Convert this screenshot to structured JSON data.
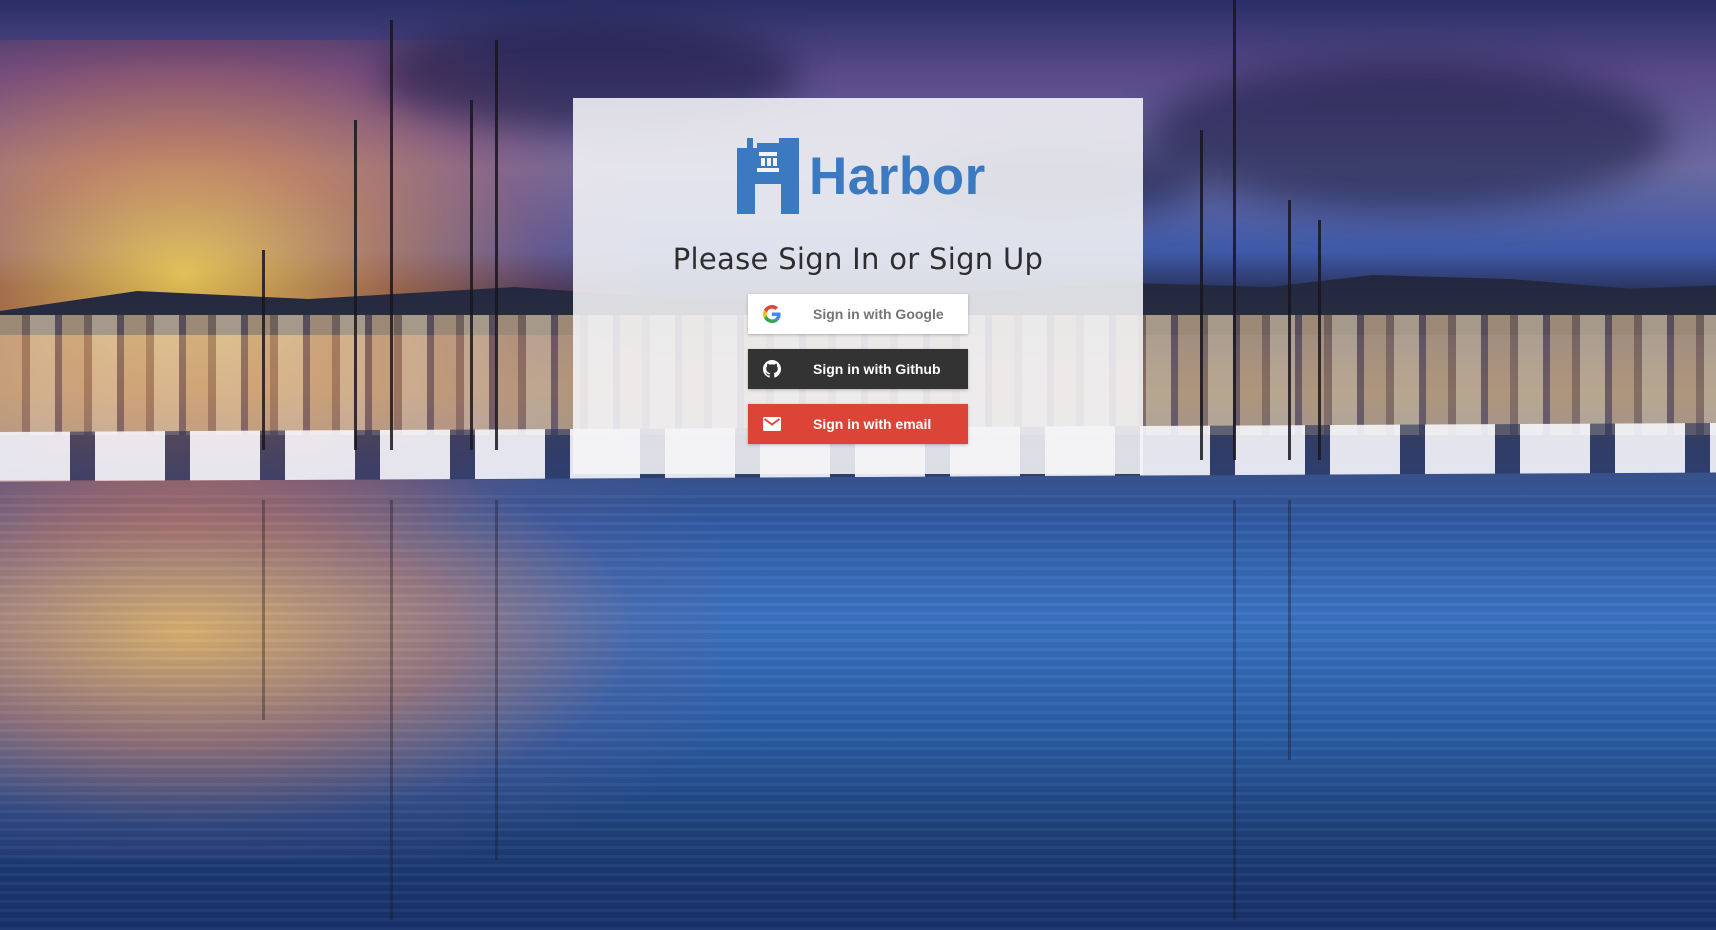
{
  "brand": {
    "name": "Harbor",
    "color": "#3b79c0"
  },
  "heading": "Please Sign In or Sign Up",
  "buttons": {
    "google": {
      "label": "Sign in with Google",
      "icon": "google-icon",
      "bg": "#ffffff",
      "fg": "#757575"
    },
    "github": {
      "label": "Sign in with Github",
      "icon": "github-icon",
      "bg": "#333333",
      "fg": "#ffffff"
    },
    "email": {
      "label": "Sign in with email",
      "icon": "mail-icon",
      "bg": "#db4437",
      "fg": "#ffffff"
    }
  }
}
